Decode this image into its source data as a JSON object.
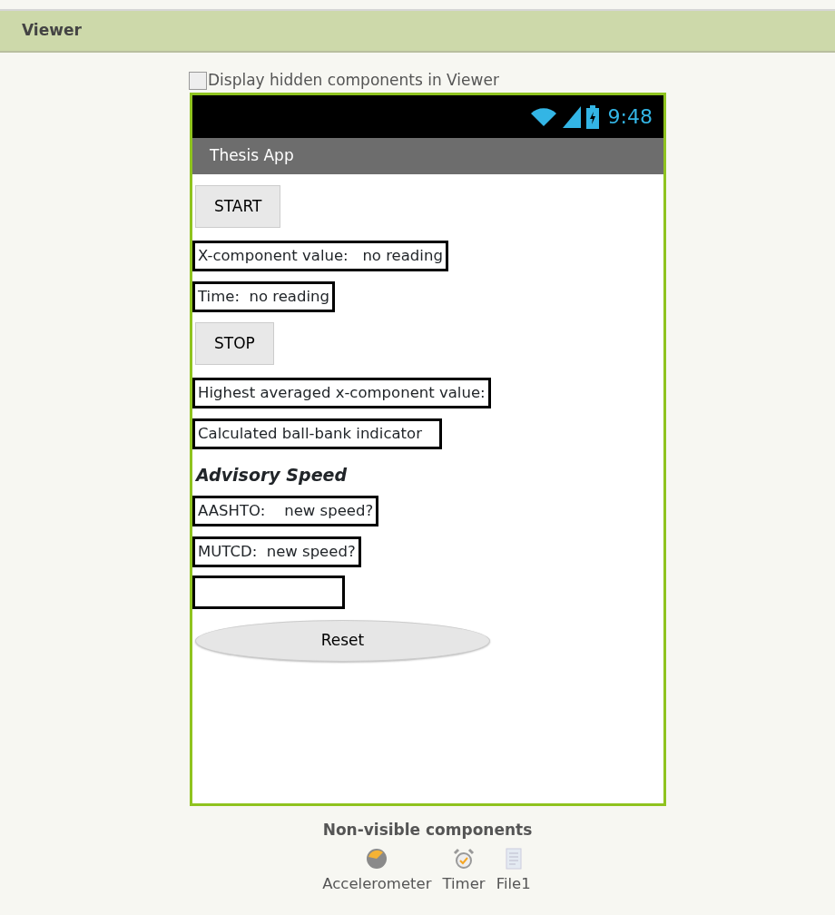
{
  "panel": {
    "title": "Viewer"
  },
  "hidden_toggle": {
    "label": "Display hidden components in Viewer",
    "checked": false
  },
  "phone": {
    "time": "9:48",
    "app_title": "Thesis App",
    "components": [
      {
        "kind": "button",
        "text": "START"
      },
      {
        "kind": "label",
        "text": "X-component value:   no reading"
      },
      {
        "kind": "label",
        "text": "Time:  no reading"
      },
      {
        "kind": "button",
        "text": "STOP"
      },
      {
        "kind": "label",
        "text": "Highest averaged x-component value:"
      },
      {
        "kind": "label",
        "text": "Calculated ball-bank indicator   "
      },
      {
        "kind": "heading",
        "text": "Advisory Speed"
      },
      {
        "kind": "label",
        "text": "AASHTO:    new speed?"
      },
      {
        "kind": "label",
        "text": "MUTCD:  new speed?"
      },
      {
        "kind": "empty"
      },
      {
        "kind": "oval",
        "text": "Reset"
      }
    ]
  },
  "non_visible": {
    "title": "Non-visible components",
    "items": [
      {
        "kind": "gauge",
        "label": "Accelerometer"
      },
      {
        "kind": "clock",
        "label": "Timer"
      },
      {
        "kind": "file",
        "label": "File1"
      }
    ]
  }
}
